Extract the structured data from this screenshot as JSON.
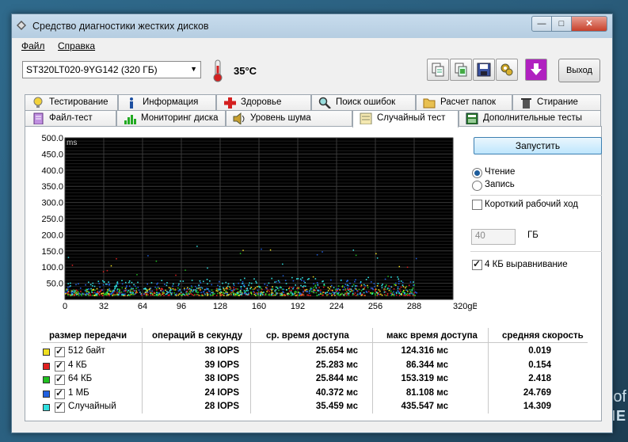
{
  "window": {
    "title": "Средство диагностики жестких дисков",
    "controls": {
      "minimize": "—",
      "maximize": "□",
      "close": "✕"
    }
  },
  "menu": {
    "items": [
      "Файл",
      "Справка"
    ]
  },
  "toolbar": {
    "drive": "ST320LT020-9YG142 (320 ГБ)",
    "temperature": "35°C",
    "exit_label": "Выход",
    "icon_buttons": [
      "copy-icon",
      "copy-all-icon",
      "save-icon",
      "settings-icon",
      "download-icon"
    ]
  },
  "tabs": {
    "row1": [
      {
        "label": "Тестирование",
        "icon": "lightbulb-icon"
      },
      {
        "label": "Информация",
        "icon": "info-icon"
      },
      {
        "label": "Здоровье",
        "icon": "health-cross-icon"
      },
      {
        "label": "Поиск ошибок",
        "icon": "search-icon"
      },
      {
        "label": "Расчет папок",
        "icon": "folder-icon"
      },
      {
        "label": "Стирание",
        "icon": "trash-icon"
      }
    ],
    "row2": [
      {
        "label": "Файл-тест",
        "icon": "file-test-icon"
      },
      {
        "label": "Мониторинг диска",
        "icon": "monitor-icon"
      },
      {
        "label": "Уровень шума",
        "icon": "speaker-icon"
      },
      {
        "label": "Случайный тест",
        "icon": "random-test-icon",
        "active": true
      },
      {
        "label": "Дополнительные тесты",
        "icon": "extra-tests-icon"
      }
    ]
  },
  "controls": {
    "run_label": "Запустить",
    "read_label": "Чтение",
    "write_label": "Запись",
    "read_selected": true,
    "short_stroke_label": "Короткий рабочий ход",
    "short_stroke_checked": false,
    "short_stroke_value": "40",
    "short_stroke_unit": "ГБ",
    "align_label": "4 КБ выравнивание",
    "align_checked": true
  },
  "results": {
    "headers": [
      "размер передачи",
      "операций в секунду",
      "ср. время доступа",
      "макс время доступа",
      "средняя скорость"
    ],
    "rows": [
      {
        "color": "#f0e020",
        "label": "512 байт",
        "iops": "38 IOPS",
        "avg": "25.654 мс",
        "max": "124.316 мс",
        "speed": "0.019"
      },
      {
        "color": "#e02020",
        "label": "4 КБ",
        "iops": "39 IOPS",
        "avg": "25.283 мс",
        "max": "86.344 мс",
        "speed": "0.154"
      },
      {
        "color": "#20c020",
        "label": "64 КБ",
        "iops": "38 IOPS",
        "avg": "25.844 мс",
        "max": "153.319 мс",
        "speed": "2.418"
      },
      {
        "color": "#2060e0",
        "label": "1 МБ",
        "iops": "24 IOPS",
        "avg": "40.372 мс",
        "max": "81.108 мс",
        "speed": "24.769"
      },
      {
        "color": "#30e0e0",
        "label": "Случайный",
        "iops": "28 IOPS",
        "avg": "35.459 мс",
        "max": "435.547 мс",
        "speed": "14.309"
      }
    ]
  },
  "chart_data": {
    "type": "scatter",
    "ylabel": "ms",
    "xunit": "gB",
    "xlim": [
      0,
      320
    ],
    "ylim": [
      0,
      500
    ],
    "yticks": [
      "500.0",
      "450.0",
      "400.0",
      "350.0",
      "300.0",
      "250.0",
      "200.0",
      "150.0",
      "100.0",
      "50.0"
    ],
    "xticks": [
      "0",
      "32",
      "64",
      "96",
      "128",
      "160",
      "192",
      "224",
      "256",
      "288",
      "320gB"
    ],
    "grid": true,
    "background": "#000000",
    "series": [
      {
        "color": "#f0e020",
        "band": [
          14,
          34
        ]
      },
      {
        "color": "#e02020",
        "band": [
          14,
          32
        ]
      },
      {
        "color": "#20c020",
        "band": [
          14,
          36
        ]
      },
      {
        "color": "#2060e0",
        "band": [
          18,
          52
        ]
      },
      {
        "color": "#30e0e0",
        "band": [
          16,
          60
        ]
      }
    ]
  },
  "desktop": {
    "text1": "of",
    "text2": "NE"
  }
}
